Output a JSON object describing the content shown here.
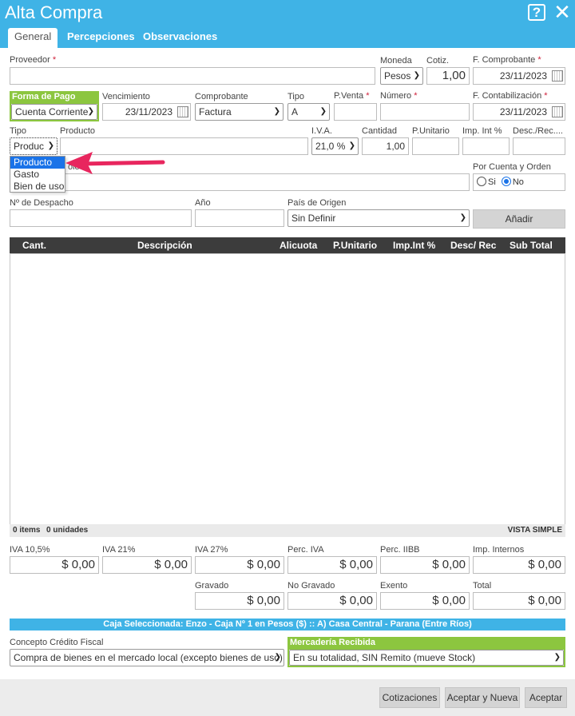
{
  "window": {
    "title": "Alta Compra",
    "help_icon": "?",
    "close_icon": "✕"
  },
  "tabs": [
    "General",
    "Percepciones",
    "Observaciones"
  ],
  "row1": {
    "proveedor_label": "Proveedor",
    "proveedor_value": "",
    "moneda_label": "Moneda",
    "moneda_value": "Pesos",
    "cotiz_label": "Cotiz.",
    "cotiz_value": "1,00",
    "f_comprobante_label": "F. Comprobante",
    "f_comprobante_value": "23/11/2023"
  },
  "row2": {
    "forma_pago_label": "Forma de Pago",
    "forma_pago_value": "Cuenta Corriente",
    "vencimiento_label": "Vencimiento",
    "vencimiento_value": "23/11/2023",
    "comprobante_label": "Comprobante",
    "comprobante_value": "Factura",
    "tipo_label": "Tipo",
    "tipo_value": "A",
    "pventa_label": "P.Venta",
    "numero_label": "Número",
    "f_contab_label": "F. Contabilización",
    "f_contab_value": "23/11/2023"
  },
  "row3": {
    "tipo_label": "Tipo",
    "tipo_value": "Produc",
    "producto_label": "Producto",
    "iva_label": "I.V.A.",
    "iva_value": "21,0 %",
    "cantidad_label": "Cantidad",
    "cantidad_value": "1,00",
    "punitario_label": "P.Unitario",
    "impint_label": "Imp. Int %",
    "desc_label": "Desc./Rec...."
  },
  "tipo_dropdown": [
    "Producto",
    "Gasto",
    "Bien de uso"
  ],
  "row4": {
    "partial_label": "ole",
    "por_cuenta_label": "Por Cuenta y Orden",
    "radio_si": "Si",
    "radio_no": "No"
  },
  "row5": {
    "despacho_label": "Nº de Despacho",
    "anio_label": "Año",
    "pais_label": "País de Origen",
    "pais_value": "Sin Definir",
    "anadir_label": "Añadir"
  },
  "grid": {
    "columns": [
      "Cant.",
      "Descripción",
      "Alicuota",
      "P.Unitario",
      "Imp.Int %",
      "Desc/ Rec",
      "Sub Total"
    ],
    "items_count": "0 items",
    "units_count": "0 unidades",
    "view_toggle": "VISTA SIMPLE"
  },
  "totals": [
    {
      "label": "IVA 10,5%",
      "value": "$ 0,00"
    },
    {
      "label": "IVA 21%",
      "value": "$ 0,00"
    },
    {
      "label": "IVA 27%",
      "value": "$ 0,00"
    },
    {
      "label": "Perc. IVA",
      "value": "$ 0,00"
    },
    {
      "label": "Perc. IIBB",
      "value": "$ 0,00"
    },
    {
      "label": "Imp. Internos",
      "value": "$ 0,00"
    },
    {
      "label": "Gravado",
      "value": "$ 0,00"
    },
    {
      "label": "No Gravado",
      "value": "$ 0,00"
    },
    {
      "label": "Exento",
      "value": "$ 0,00"
    },
    {
      "label": "Total",
      "value": "$ 0,00"
    }
  ],
  "caja_info": "Caja Seleccionada: Enzo - Caja Nº 1 en Pesos ($) :: A) Casa Central - Parana (Entre Ríos)",
  "concepto": {
    "label": "Concepto Crédito Fiscal",
    "value": "Compra de bienes en el mercado local (excepto bienes de uso)"
  },
  "mercaderia": {
    "label": "Mercadería Recibida",
    "value": "En su totalidad, SIN Remito (mueve Stock)"
  },
  "footer": {
    "cotizaciones": "Cotizaciones",
    "aceptar_nueva": "Aceptar y Nueva",
    "aceptar": "Aceptar"
  },
  "colors": {
    "header": "#3fb3e6",
    "green": "#8cc63f",
    "grid_header": "#3c3c3c",
    "arrow": "#e8265e"
  }
}
